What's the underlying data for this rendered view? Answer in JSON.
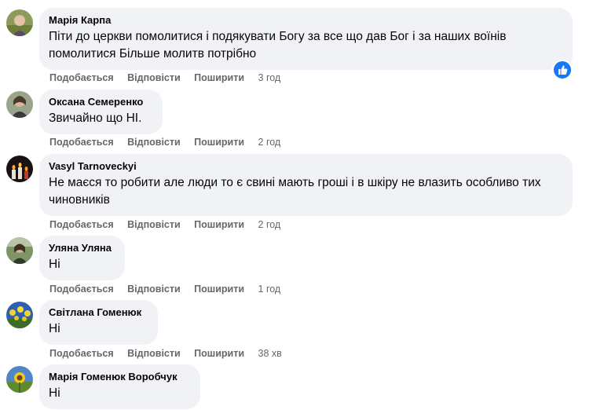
{
  "labels": {
    "like": "Подобається",
    "reply": "Відповісти",
    "share": "Поширити"
  },
  "comments": [
    {
      "author": "Марія Карпа",
      "text": "Піти до церкви помолитися і подякувати Богу за все що дав Бог і за наших воїнів помолитися Більше молитв потрібно",
      "time": "3 год",
      "reaction": "like-icon"
    },
    {
      "author": "Оксана Семеренко",
      "text": "Звичайно що НІ.",
      "time": "2 год"
    },
    {
      "author": "Vasyl Tarnoveckyi",
      "text": "Не маєся то робити але люди то є свині мають гроші і в шкіру не влазить особливо тих чиновників",
      "time": "2 год"
    },
    {
      "author": "Уляна Уляна",
      "text": "Ні",
      "time": "1 год"
    },
    {
      "author": "Світлана Гоменюк",
      "text": "Ні",
      "time": "38 хв"
    },
    {
      "author": "Марія Гоменюк Воробчук",
      "text": "Ні"
    }
  ],
  "colors": {
    "bubble": "#f0f2f5",
    "meta": "#65676b",
    "like_blue": "#1877f2"
  }
}
